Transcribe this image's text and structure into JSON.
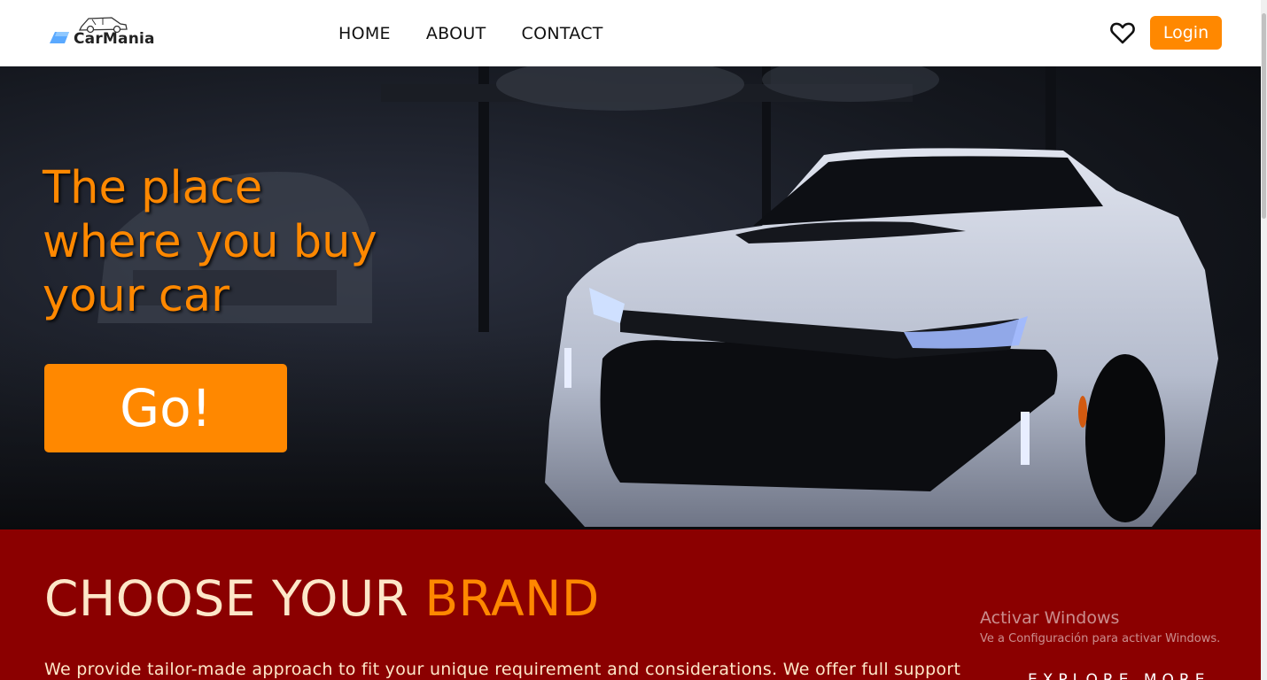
{
  "header": {
    "logo_text": "CarMania",
    "nav": [
      {
        "label": "HOME"
      },
      {
        "label": "ABOUT"
      },
      {
        "label": "CONTACT"
      }
    ],
    "login_label": "Login"
  },
  "hero": {
    "title": "The place where you buy your car",
    "cta_label": "Go!"
  },
  "brand": {
    "title_prefix": "CHOOSE YOUR",
    "title_accent": "BRAND",
    "description": "We provide tailor-made approach to fit your unique requirement and considerations. We offer full support",
    "explore_label": "EXPLORE MORE"
  },
  "watermark": {
    "title": "Activar Windows",
    "subtitle": "Ve a Configuración para activar Windows."
  },
  "colors": {
    "accent": "#ff8800",
    "section_bg": "#8b0000",
    "cream_text": "#fde7c8"
  }
}
